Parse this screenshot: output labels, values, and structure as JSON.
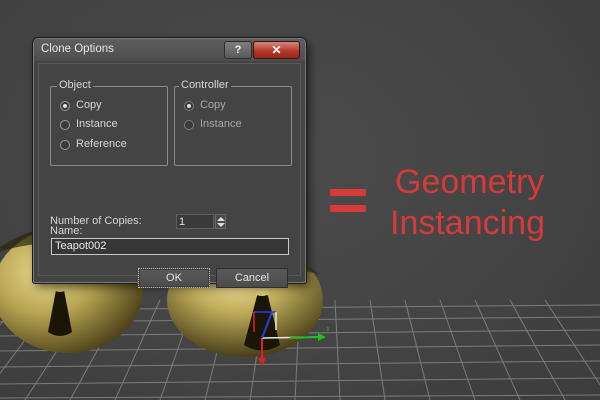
{
  "dialog": {
    "title": "Clone Options",
    "help_label": "?",
    "close_label": "✕",
    "object_group": {
      "legend": "Object",
      "options": [
        "Copy",
        "Instance",
        "Reference"
      ],
      "selected": "Copy"
    },
    "controller_group": {
      "legend": "Controller",
      "options": [
        "Copy",
        "Instance"
      ],
      "selected": "Copy"
    },
    "copies_label": "Number of Copies:",
    "copies_value": "1",
    "name_label": "Name:",
    "name_value": "Teapot002",
    "ok_label": "OK",
    "cancel_label": "Cancel"
  },
  "caption": {
    "symbol": "=",
    "line1": "Geometry",
    "line2": "Instancing",
    "color": "#d83a3a"
  },
  "scene": {
    "objects": [
      "teapot",
      "teapot"
    ],
    "gizmo_colors": [
      "#e02020",
      "#20c020",
      "#2040e0"
    ]
  }
}
